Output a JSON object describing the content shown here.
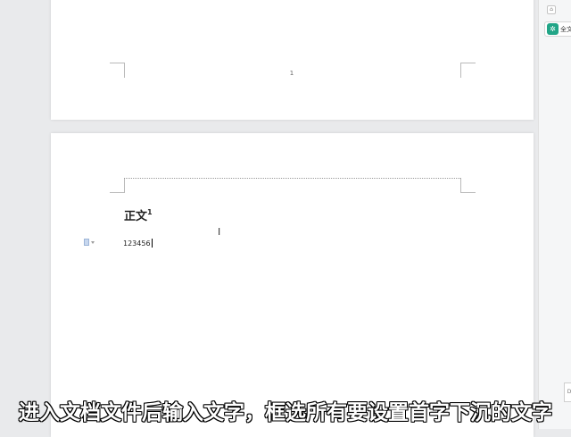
{
  "document": {
    "page1": {
      "footer_page_number": "1"
    },
    "page2": {
      "heading": "正文",
      "heading_footnote": "1",
      "body_text": "123456"
    }
  },
  "right_panel": {
    "top_icon": "home-icon",
    "full_text_button_label": "全文",
    "corner_label": "D"
  },
  "subtitle": "进入文档文件后输入文字，框选所有要设置首字下沉的文字",
  "colors": {
    "workspace_bg": "#e9eaec",
    "page_bg": "#ffffff",
    "accent_teal": "#21a587"
  }
}
